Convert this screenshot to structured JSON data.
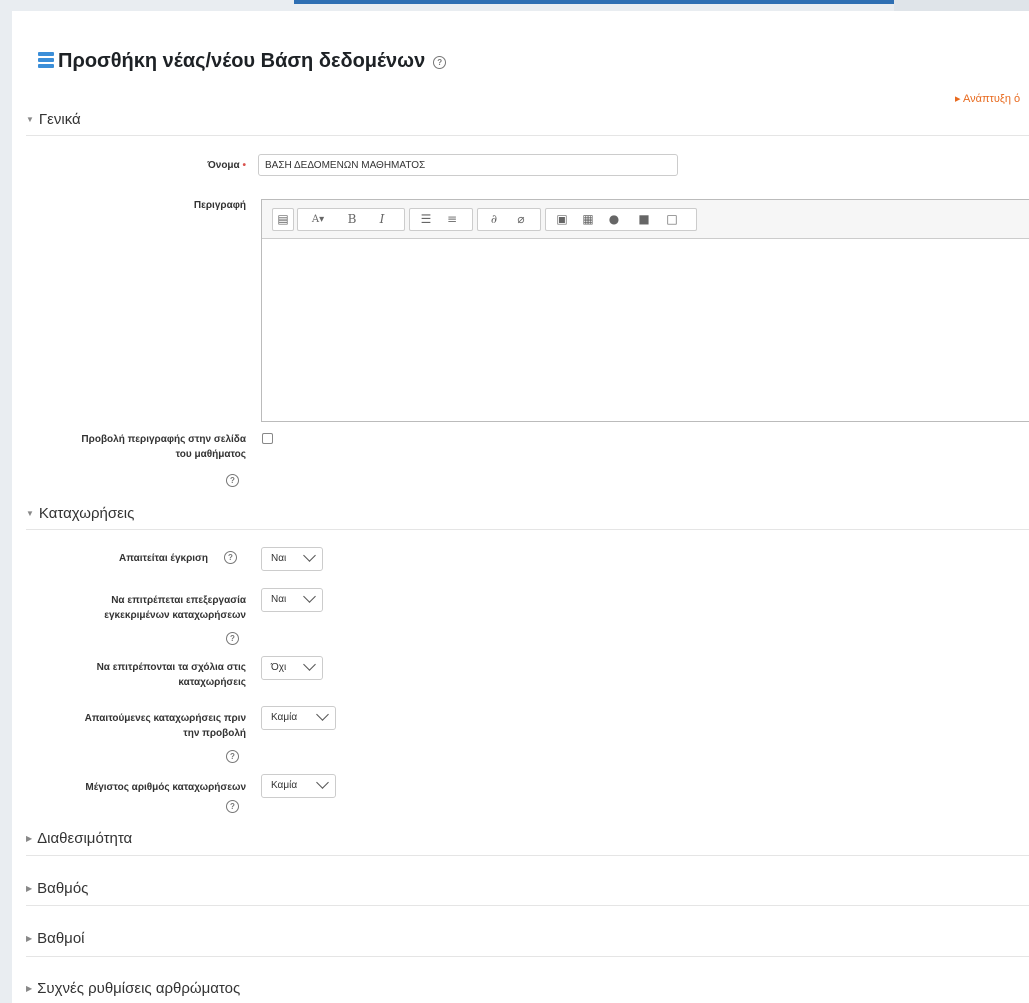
{
  "page": {
    "title": "Προσθήκη νέας/νέου Βάση δεδομένων",
    "title_icon": "database-icon",
    "help_icon_glyph": "?",
    "expand_all": "▸ Ανάπτυξη ό"
  },
  "sections": {
    "general": "Γενικά",
    "entries": "Καταχωρήσεις",
    "availability": "Διαθεσιμότητα",
    "grade": "Βαθμός",
    "grades": "Βαθμοί",
    "common_settings": "Συχνές ρυθμίσεις αρθρώματος"
  },
  "general": {
    "name_label": "Όνομα",
    "required_marker": "•",
    "name_value": "ΒΑΣΗ ΔΕΔΟΜΕΝΩΝ ΜΑΘΗΜΑΤΟΣ",
    "description_label": "Περιγραφή",
    "show_description_label_line1": "Προβολή περιγραφής στην σελίδα",
    "show_description_label_line2": "του μαθήματος",
    "show_description_checked": false
  },
  "editor_toolbar": {
    "buttons": [
      "toggle-toolbar-icon",
      "text-style-icon",
      "bold-icon",
      "italic-icon",
      "unordered-list-icon",
      "ordered-list-icon",
      "link-icon",
      "unlink-icon",
      "image-icon",
      "media-icon",
      "record-audio-icon",
      "record-video-icon",
      "manage-files-icon"
    ],
    "bold_glyph": "B",
    "italic_glyph": "I",
    "style_glyph": "A▾"
  },
  "entries": {
    "approval_label": "Απαιτείται έγκριση",
    "approval_value": "Ναι",
    "allow_edit_label_line1": "Να επιτρέπεται επεξεργασία",
    "allow_edit_label_line2": "εγκεκριμένων καταχωρήσεων",
    "allow_edit_value": "Ναι",
    "comments_label_line1": "Να επιτρέπονται τα σχόλια στις",
    "comments_label_line2": "καταχωρήσεις",
    "comments_value": "Όχι",
    "required_before_view_label_line1": "Απαιτούμενες καταχωρήσεις πριν",
    "required_before_view_label_line2": "την προβολή",
    "required_before_view_value": "Καμία",
    "max_entries_label": "Μέγιστος αριθμός καταχωρήσεων",
    "max_entries_value": "Καμία"
  },
  "colors": {
    "accent_link": "#e8691d",
    "icon_blue": "#3b8ed8",
    "required": "#d9534f"
  }
}
